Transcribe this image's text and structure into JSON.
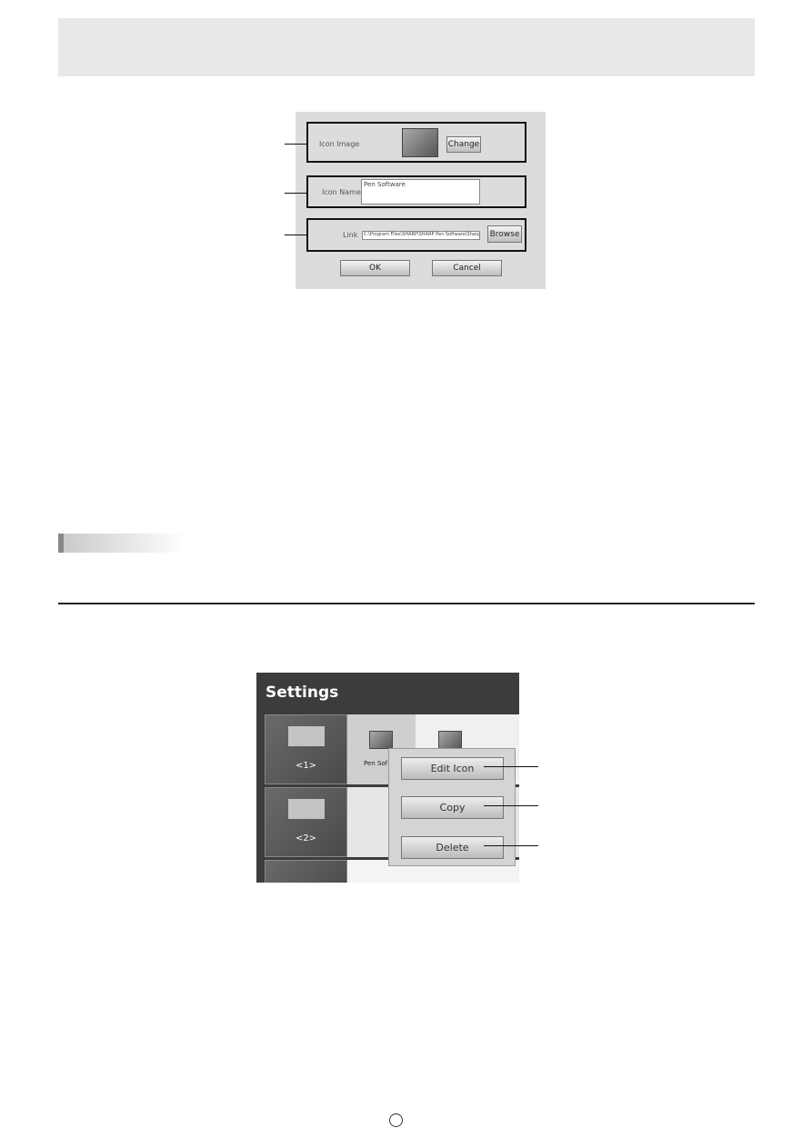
{
  "dialog": {
    "icon_image_label": "Icon Image",
    "change_label": "Change",
    "icon_name_label": "Icon Name",
    "icon_name_value": "Pen Software",
    "link_label": "Link",
    "link_value": "C:\\Program Files\\SHARP\\SHARP Pen Software\\SharpPen.exe",
    "browse_label": "Browse",
    "ok_label": "OK",
    "cancel_label": "Cancel"
  },
  "settings": {
    "title": "Settings",
    "groups": [
      "<1>",
      "<2>"
    ],
    "icon_label": "Pen Sof",
    "menu": [
      "Edit Icon",
      "Copy",
      "Delete"
    ]
  }
}
